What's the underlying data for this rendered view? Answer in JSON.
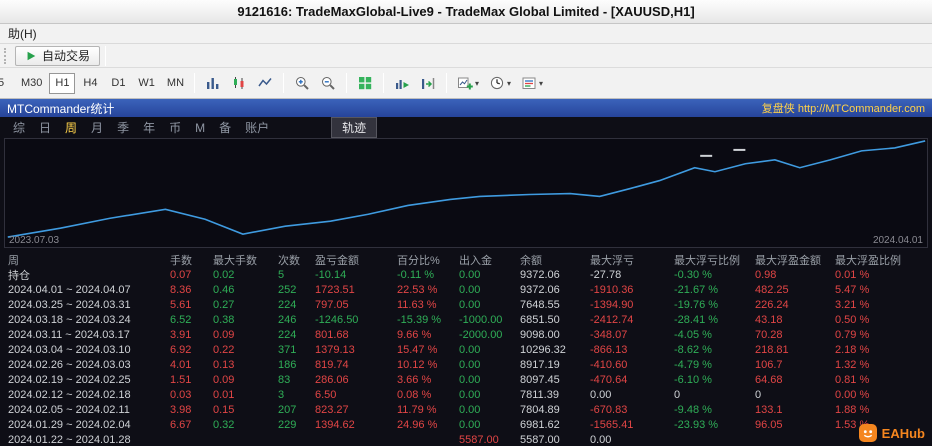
{
  "window": {
    "title": "9121616: TradeMaxGlobal-Live9 - TradeMax Global Limited - [XAUUSD,H1]"
  },
  "menus": {
    "help": "助(H)"
  },
  "toolbar": {
    "auto_trading_label": "自动交易",
    "auto_trading_icon": "play-icon",
    "timeframes": [
      "5",
      "M30",
      "H1",
      "H4",
      "D1",
      "W1",
      "MN"
    ],
    "selected_timeframe": "H1",
    "icon_groups": [
      {
        "items": [
          {
            "icon": "chart-bars-icon"
          },
          {
            "icon": "chart-candles-icon"
          },
          {
            "icon": "chart-line-icon"
          }
        ]
      },
      {
        "items": [
          {
            "icon": "zoom-in-icon"
          },
          {
            "icon": "zoom-out-icon"
          }
        ]
      },
      {
        "items": [
          {
            "icon": "tile-windows-icon"
          }
        ]
      },
      {
        "items": [
          {
            "icon": "auto-scroll-icon"
          },
          {
            "icon": "chart-shift-icon"
          }
        ]
      },
      {
        "items": [
          {
            "icon": "new-chart-icon",
            "caret": true
          },
          {
            "icon": "periods-icon",
            "caret": true
          },
          {
            "icon": "templates-icon",
            "caret": true
          }
        ]
      }
    ]
  },
  "panel": {
    "title": "MTCommander统计",
    "header_right": "复盘侠 http://MTCommander.com",
    "tabs": [
      "综",
      "日",
      "周",
      "月",
      "季",
      "年",
      "币",
      "M",
      "备",
      "账户"
    ],
    "selected_tab": "周",
    "track_tab": "轨迹",
    "chart": {
      "type": "line",
      "start_label": "2023.07.03",
      "end_label": "2024.04.01",
      "line_color": "#3f9be0",
      "points": [
        [
          0.3,
          90.8
        ],
        [
          6,
          82.6
        ],
        [
          11.4,
          73.4
        ],
        [
          17.4,
          65.1
        ],
        [
          21.7,
          74.3
        ],
        [
          25.8,
          88.1
        ],
        [
          30.4,
          80.7
        ],
        [
          35.3,
          76.1
        ],
        [
          39.4,
          69.7
        ],
        [
          43.7,
          61.5
        ],
        [
          48.3,
          56
        ],
        [
          51.5,
          53.2
        ],
        [
          56.9,
          51.4
        ],
        [
          61.3,
          50.5
        ],
        [
          64.5,
          53.2
        ],
        [
          67.8,
          45.9
        ],
        [
          71,
          38.5
        ],
        [
          74.8,
          26.6
        ],
        [
          77,
          30.3
        ],
        [
          80.3,
          22.9
        ],
        [
          83.5,
          19.3
        ],
        [
          86.2,
          26.6
        ],
        [
          89.5,
          19.3
        ],
        [
          92.9,
          11
        ],
        [
          96.5,
          8.3
        ],
        [
          99.8,
          1.8
        ]
      ],
      "dashes": [
        [
          75.4,
          15.6,
          76.7,
          15.6
        ],
        [
          79,
          10.1,
          80.3,
          10.1
        ]
      ]
    },
    "table": {
      "columns": [
        "周",
        "手数",
        "最大手数",
        "次数",
        "盈亏金额",
        "百分比%",
        "出入金",
        "余额",
        "最大浮亏",
        "最大浮亏比例",
        "最大浮盈金额",
        "最大浮盈比例"
      ],
      "rows": [
        [
          [
            "持仓",
            "w"
          ],
          [
            "0.07",
            "r"
          ],
          [
            "0.02",
            "g"
          ],
          [
            "5",
            "g"
          ],
          [
            "-10.14",
            "g"
          ],
          [
            "-0.11 %",
            "g"
          ],
          [
            "0.00",
            "g"
          ],
          [
            "9372.06",
            "w"
          ],
          [
            "-27.78",
            "w"
          ],
          [
            "-0.30 %",
            "g"
          ],
          [
            "0.98",
            "r"
          ],
          [
            "0.01 %",
            "r"
          ]
        ],
        [
          [
            "2024.04.01 ~ 2024.04.07",
            "w"
          ],
          [
            "8.36",
            "r"
          ],
          [
            "0.46",
            "g"
          ],
          [
            "252",
            "g"
          ],
          [
            "1723.51",
            "r"
          ],
          [
            "22.53 %",
            "r"
          ],
          [
            "0.00",
            "g"
          ],
          [
            "9372.06",
            "w"
          ],
          [
            "-1910.36",
            "r"
          ],
          [
            "-21.67 %",
            "g"
          ],
          [
            "482.25",
            "r"
          ],
          [
            "5.47 %",
            "r"
          ]
        ],
        [
          [
            "2024.03.25 ~ 2024.03.31",
            "w"
          ],
          [
            "5.61",
            "r"
          ],
          [
            "0.27",
            "g"
          ],
          [
            "224",
            "g"
          ],
          [
            "797.05",
            "r"
          ],
          [
            "11.63 %",
            "r"
          ],
          [
            "0.00",
            "g"
          ],
          [
            "7648.55",
            "w"
          ],
          [
            "-1394.90",
            "r"
          ],
          [
            "-19.76 %",
            "g"
          ],
          [
            "226.24",
            "r"
          ],
          [
            "3.21 %",
            "r"
          ]
        ],
        [
          [
            "2024.03.18 ~ 2024.03.24",
            "w"
          ],
          [
            "6.52",
            "g"
          ],
          [
            "0.38",
            "g"
          ],
          [
            "246",
            "g"
          ],
          [
            "-1246.50",
            "g"
          ],
          [
            "-15.39 %",
            "g"
          ],
          [
            "-1000.00",
            "g"
          ],
          [
            "6851.50",
            "w"
          ],
          [
            "-2412.74",
            "r"
          ],
          [
            "-28.41 %",
            "g"
          ],
          [
            "43.18",
            "r"
          ],
          [
            "0.50 %",
            "r"
          ]
        ],
        [
          [
            "2024.03.11 ~ 2024.03.17",
            "w"
          ],
          [
            "3.91",
            "r"
          ],
          [
            "0.09",
            "r"
          ],
          [
            "224",
            "g"
          ],
          [
            "801.68",
            "r"
          ],
          [
            "9.66 %",
            "r"
          ],
          [
            "-2000.00",
            "g"
          ],
          [
            "9098.00",
            "w"
          ],
          [
            "-348.07",
            "r"
          ],
          [
            "-4.05 %",
            "g"
          ],
          [
            "70.28",
            "r"
          ],
          [
            "0.79 %",
            "r"
          ]
        ],
        [
          [
            "2024.03.04 ~ 2024.03.10",
            "w"
          ],
          [
            "6.92",
            "r"
          ],
          [
            "0.22",
            "r"
          ],
          [
            "371",
            "g"
          ],
          [
            "1379.13",
            "r"
          ],
          [
            "15.47 %",
            "r"
          ],
          [
            "0.00",
            "g"
          ],
          [
            "10296.32",
            "w"
          ],
          [
            "-866.13",
            "r"
          ],
          [
            "-8.62 %",
            "g"
          ],
          [
            "218.81",
            "r"
          ],
          [
            "2.18 %",
            "r"
          ]
        ],
        [
          [
            "2024.02.26 ~ 2024.03.03",
            "w"
          ],
          [
            "4.01",
            "r"
          ],
          [
            "0.13",
            "r"
          ],
          [
            "186",
            "g"
          ],
          [
            "819.74",
            "r"
          ],
          [
            "10.12 %",
            "r"
          ],
          [
            "0.00",
            "g"
          ],
          [
            "8917.19",
            "w"
          ],
          [
            "-410.60",
            "r"
          ],
          [
            "-4.79 %",
            "g"
          ],
          [
            "106.7",
            "r"
          ],
          [
            "1.32 %",
            "r"
          ]
        ],
        [
          [
            "2024.02.19 ~ 2024.02.25",
            "w"
          ],
          [
            "1.51",
            "r"
          ],
          [
            "0.09",
            "r"
          ],
          [
            "83",
            "g"
          ],
          [
            "286.06",
            "r"
          ],
          [
            "3.66 %",
            "r"
          ],
          [
            "0.00",
            "g"
          ],
          [
            "8097.45",
            "w"
          ],
          [
            "-470.64",
            "r"
          ],
          [
            "-6.10 %",
            "g"
          ],
          [
            "64.68",
            "r"
          ],
          [
            "0.81 %",
            "r"
          ]
        ],
        [
          [
            "2024.02.12 ~ 2024.02.18",
            "w"
          ],
          [
            "0.03",
            "r"
          ],
          [
            "0.01",
            "r"
          ],
          [
            "3",
            "g"
          ],
          [
            "6.50",
            "r"
          ],
          [
            "0.08 %",
            "r"
          ],
          [
            "0.00",
            "g"
          ],
          [
            "7811.39",
            "w"
          ],
          [
            "0.00",
            "w"
          ],
          [
            "0",
            "w"
          ],
          [
            "0",
            "w"
          ],
          [
            "0.00 %",
            "r"
          ]
        ],
        [
          [
            "2024.02.05 ~ 2024.02.11",
            "w"
          ],
          [
            "3.98",
            "r"
          ],
          [
            "0.15",
            "r"
          ],
          [
            "207",
            "g"
          ],
          [
            "823.27",
            "r"
          ],
          [
            "11.79 %",
            "r"
          ],
          [
            "0.00",
            "g"
          ],
          [
            "7804.89",
            "w"
          ],
          [
            "-670.83",
            "r"
          ],
          [
            "-9.48 %",
            "g"
          ],
          [
            "133.1",
            "r"
          ],
          [
            "1.88 %",
            "r"
          ]
        ],
        [
          [
            "2024.01.29 ~ 2024.02.04",
            "w"
          ],
          [
            "6.67",
            "r"
          ],
          [
            "0.32",
            "g"
          ],
          [
            "229",
            "g"
          ],
          [
            "1394.62",
            "r"
          ],
          [
            "24.96 %",
            "r"
          ],
          [
            "0.00",
            "g"
          ],
          [
            "6981.62",
            "w"
          ],
          [
            "-1565.41",
            "r"
          ],
          [
            "-23.93 %",
            "g"
          ],
          [
            "96.05",
            "r"
          ],
          [
            "1.53 %",
            "r"
          ]
        ],
        [
          [
            "2024.01.22 ~ 2024.01.28",
            "w"
          ],
          [
            "",
            "w"
          ],
          [
            "",
            "w"
          ],
          [
            "",
            "w"
          ],
          [
            "",
            "w"
          ],
          [
            "",
            "w"
          ],
          [
            "5587.00",
            "r"
          ],
          [
            "5587.00",
            "w"
          ],
          [
            "0.00",
            "w"
          ],
          [
            "",
            "w"
          ],
          [
            "",
            "w"
          ],
          [
            "",
            "w"
          ]
        ]
      ]
    }
  },
  "watermark": {
    "text": "EAHub"
  },
  "colors": {
    "positive_red": "#e14545",
    "negative_green": "#2fae57",
    "accent_yellow": "#ffd24a",
    "chart_line": "#3f9be0",
    "header_blue": "#2c4ea6"
  }
}
